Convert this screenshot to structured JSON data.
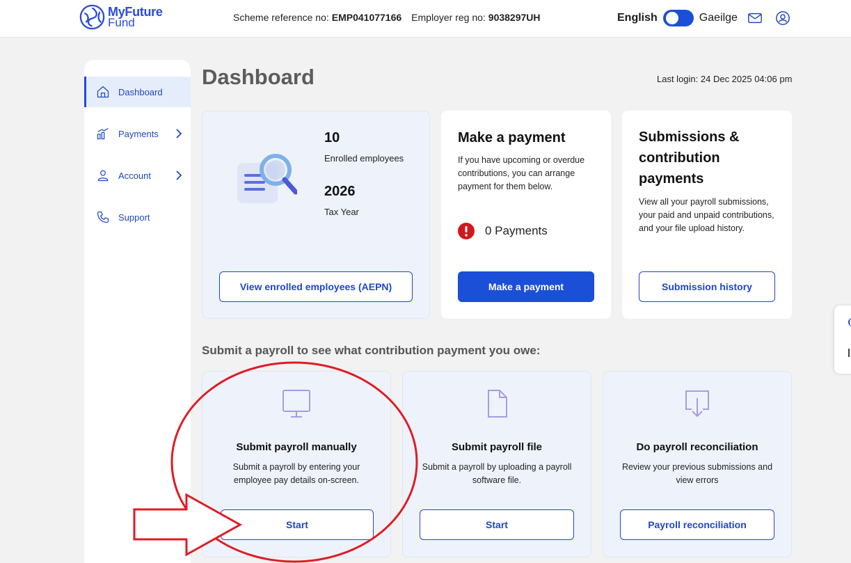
{
  "header": {
    "logo": {
      "line1": "MyFuture",
      "line2": "Fund"
    },
    "scheme_label": "Scheme reference no:",
    "scheme_value": "EMP041077166",
    "employer_label": "Employer reg no:",
    "employer_value": "9038297UH",
    "lang_en": "English",
    "lang_ga": "Gaeilge",
    "icons": [
      "mail-icon",
      "user-icon"
    ]
  },
  "sidebar": {
    "items": [
      {
        "label": "Dashboard",
        "icon": "home-icon",
        "active": true
      },
      {
        "label": "Payments",
        "icon": "chart-icon",
        "expandable": true
      },
      {
        "label": "Account",
        "icon": "person-icon",
        "expandable": true
      },
      {
        "label": "Support",
        "icon": "phone-icon"
      }
    ]
  },
  "main": {
    "title": "Dashboard",
    "last_login": "Last login: 24 Dec 2025 04:06 pm",
    "enrolled": {
      "count": "10",
      "count_label": "Enrolled employees",
      "year": "2026",
      "year_label": "Tax Year",
      "button": "View enrolled employees (AEPN)"
    },
    "payment": {
      "title": "Make a payment",
      "desc": "If you have upcoming or overdue contributions, you can arrange payment for them below.",
      "count": "0 Payments",
      "button": "Make a payment"
    },
    "submissions": {
      "title": "Submissions & contribution payments",
      "desc": "View all your payroll submissions, your paid and unpaid contributions, and your file upload history.",
      "button": "Submission history"
    },
    "section_title": "Submit a payroll to see what contribution payment you owe:",
    "options": [
      {
        "title": "Submit payroll manually",
        "desc": "Submit a payroll by entering your employee pay details on-screen.",
        "button": "Start",
        "icon": "monitor-icon"
      },
      {
        "title": "Submit payroll file",
        "desc": "Submit a payroll by uploading a payroll software file.",
        "button": "Start",
        "icon": "file-icon"
      },
      {
        "title": "Do payroll reconciliation",
        "desc": "Review your previous submissions and view errors",
        "button": "Payroll reconciliation",
        "icon": "download-icon"
      }
    ]
  },
  "colors": {
    "primary": "#1b4fd8",
    "tint": "#eef3fb",
    "annotation": "#e01b24"
  }
}
